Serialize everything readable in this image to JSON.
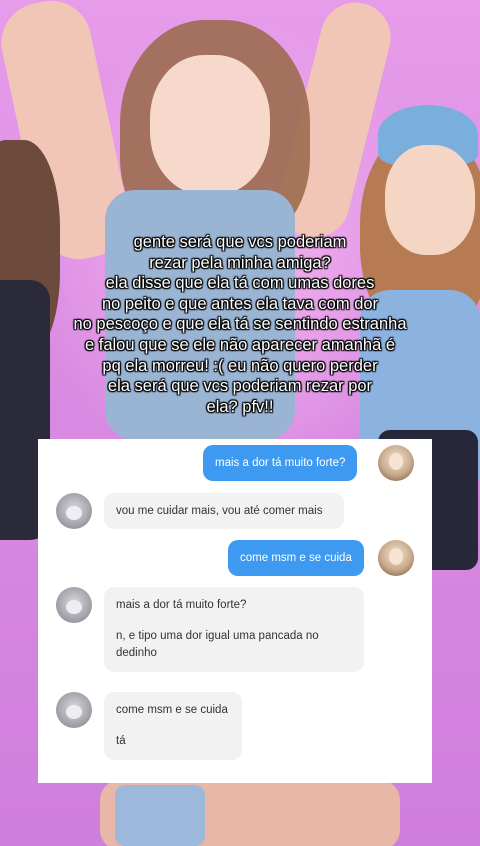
{
  "caption_lines": [
    "gente será que vcs poderiam",
    "rezar pela minha amiga?",
    "ela disse que ela tá com umas dores",
    "no peito e que antes ela tava com dor",
    "no pescoço e que ela tá se sentindo estranha",
    "e falou que se ele não aparecer amanhã é",
    "pq ela morreu! :( eu não quero perder",
    "ela será que vcs poderiam rezar por",
    "ela? pfv!!"
  ],
  "chat": {
    "msg1_out": "mais a dor tá muito forte?",
    "msg2_in": "vou me cuidar mais, vou até comer mais",
    "msg3_out": "come msm e se cuida",
    "msg4_in_quote": "mais a dor tá muito forte?",
    "msg4_in_line1": "n, e tipo uma dor igual uma pancada no",
    "msg4_in_line2": "dedinho",
    "msg5_in_quote": "come msm e se cuida",
    "msg5_in_reply": "tá"
  }
}
